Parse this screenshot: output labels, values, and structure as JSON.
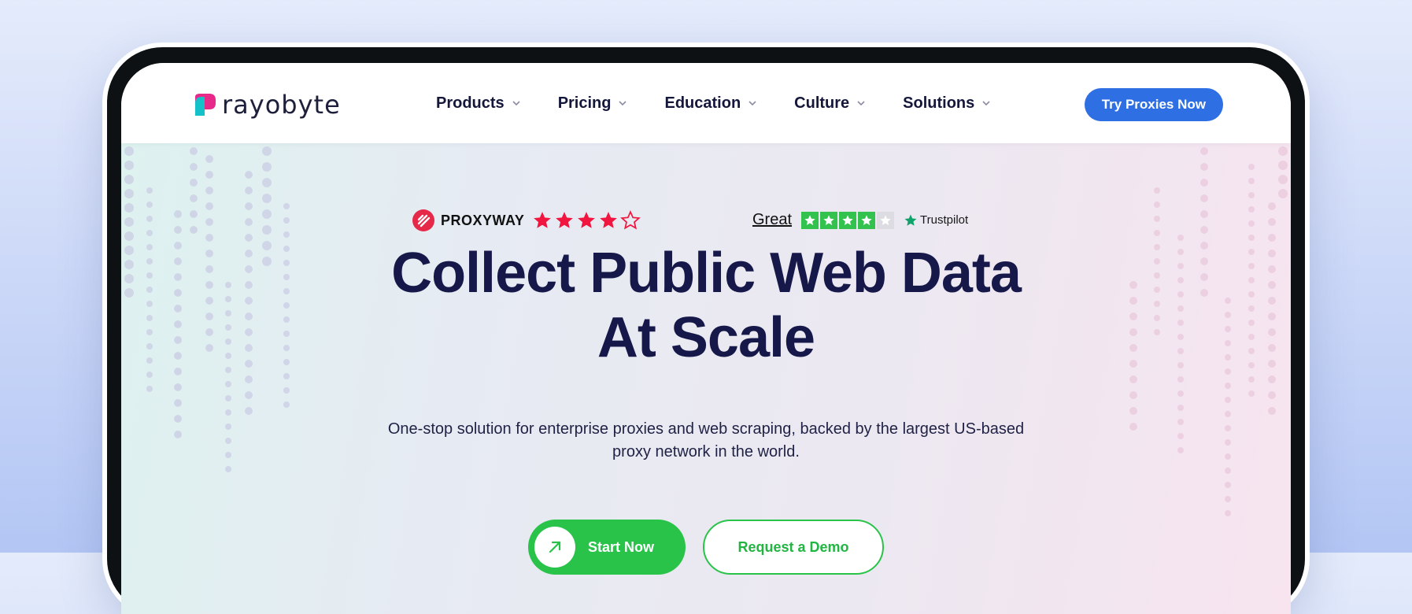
{
  "brand": {
    "name": "rayobyte",
    "accent": "#2f6fe4",
    "green": "#29c34a"
  },
  "nav": {
    "items": [
      {
        "label": "Products"
      },
      {
        "label": "Pricing"
      },
      {
        "label": "Education"
      },
      {
        "label": "Culture"
      },
      {
        "label": "Solutions"
      }
    ],
    "cta_label": "Try Proxies Now"
  },
  "ratings": {
    "proxyway": {
      "label": "PROXYWAY",
      "stars_filled": 4,
      "stars_total": 5
    },
    "trustpilot": {
      "rating_word": "Great",
      "brand": "Trustpilot",
      "stars_filled": 4,
      "stars_total": 5
    }
  },
  "hero": {
    "title_line1": "Collect Public Web Data",
    "title_line2": "At Scale",
    "subtitle_line1": "One-stop solution for enterprise proxies and web scraping, backed by the largest US-based",
    "subtitle_line2": "proxy network in the world."
  },
  "buttons": {
    "start_label": "Start Now",
    "demo_label": "Request a Demo"
  }
}
